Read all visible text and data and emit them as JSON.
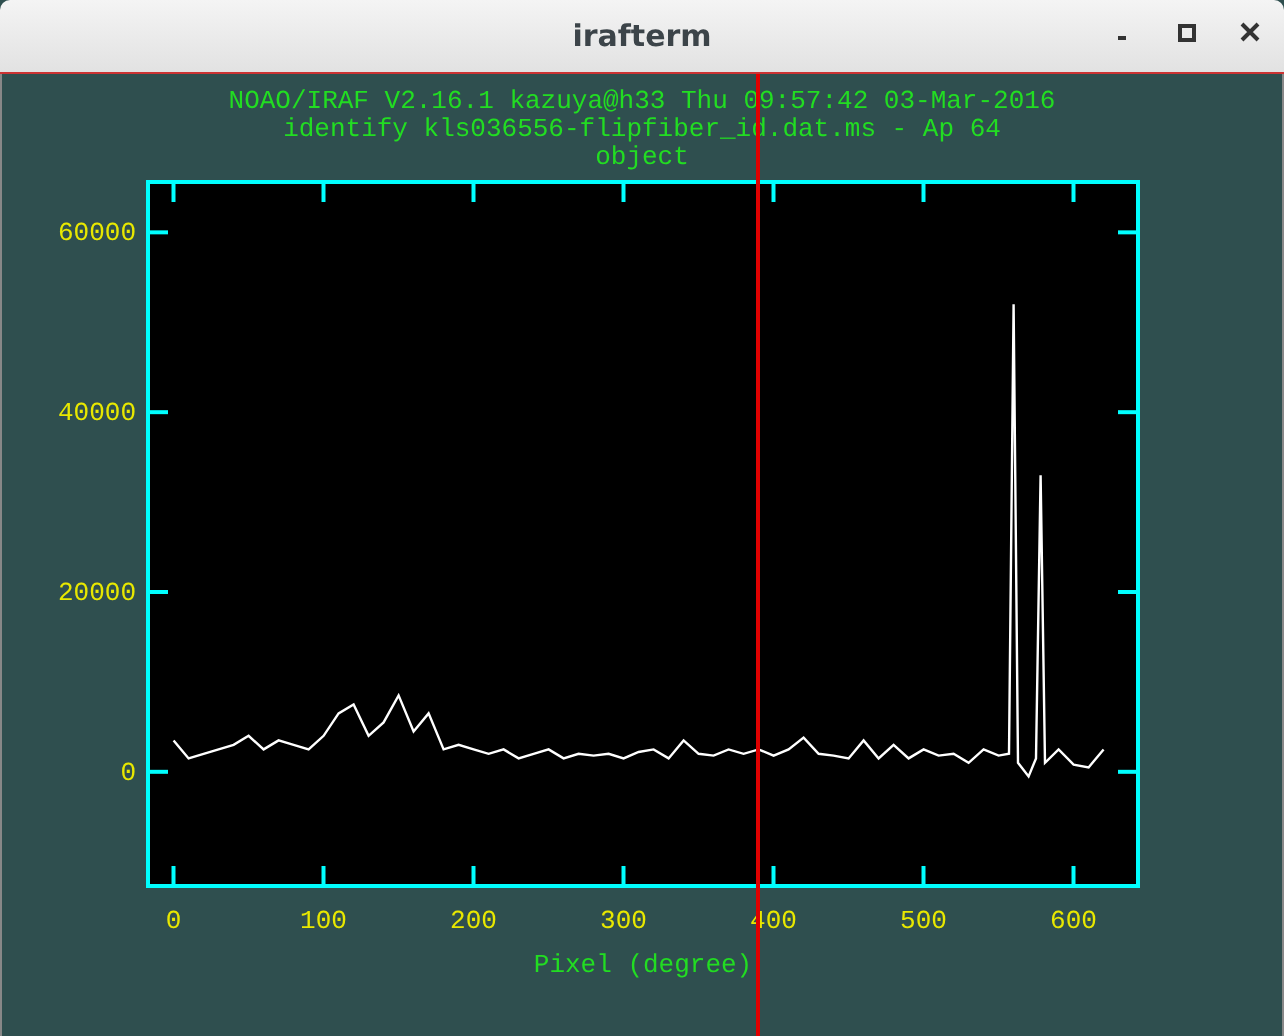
{
  "window": {
    "title": "irafterm"
  },
  "header": [
    "NOAO/IRAF V2.16.1 kazuya@h33 Thu 09:57:42 03-Mar-2016",
    "identify kls036556-flipfiber_id.dat.ms - Ap 64",
    "object"
  ],
  "plot": {
    "chart_data": {
      "type": "line",
      "xlabel": "Pixel (degree)",
      "x": [
        0,
        10,
        20,
        30,
        40,
        50,
        60,
        70,
        80,
        90,
        100,
        110,
        120,
        130,
        140,
        150,
        160,
        170,
        180,
        190,
        200,
        210,
        220,
        230,
        240,
        250,
        260,
        270,
        280,
        290,
        300,
        310,
        320,
        330,
        340,
        350,
        360,
        370,
        380,
        390,
        400,
        410,
        420,
        430,
        440,
        450,
        460,
        470,
        480,
        490,
        500,
        510,
        520,
        530,
        540,
        550,
        557,
        560,
        563,
        570,
        575,
        578,
        581,
        590,
        600,
        610,
        620
      ],
      "values": [
        3500,
        1500,
        2000,
        2500,
        3000,
        4000,
        2500,
        3500,
        3000,
        2500,
        4000,
        6500,
        7500,
        4000,
        5500,
        8500,
        4500,
        6500,
        2500,
        3000,
        2500,
        2000,
        2500,
        1500,
        2000,
        2500,
        1500,
        2000,
        1800,
        2000,
        1500,
        2200,
        2500,
        1500,
        3500,
        2000,
        1800,
        2500,
        2000,
        2500,
        1800,
        2500,
        3800,
        2000,
        1800,
        1500,
        3500,
        1500,
        3000,
        1500,
        2500,
        1800,
        2000,
        1000,
        2500,
        1800,
        2000,
        52000,
        1000,
        -500,
        1500,
        33000,
        1000,
        2500,
        800,
        500,
        2500
      ],
      "xlim": [
        -17,
        643
      ],
      "ylim": [
        -12700,
        65600
      ],
      "xticks": [
        0,
        100,
        200,
        300,
        400,
        500,
        600
      ],
      "yticks": [
        0,
        20000,
        40000,
        60000
      ]
    }
  }
}
